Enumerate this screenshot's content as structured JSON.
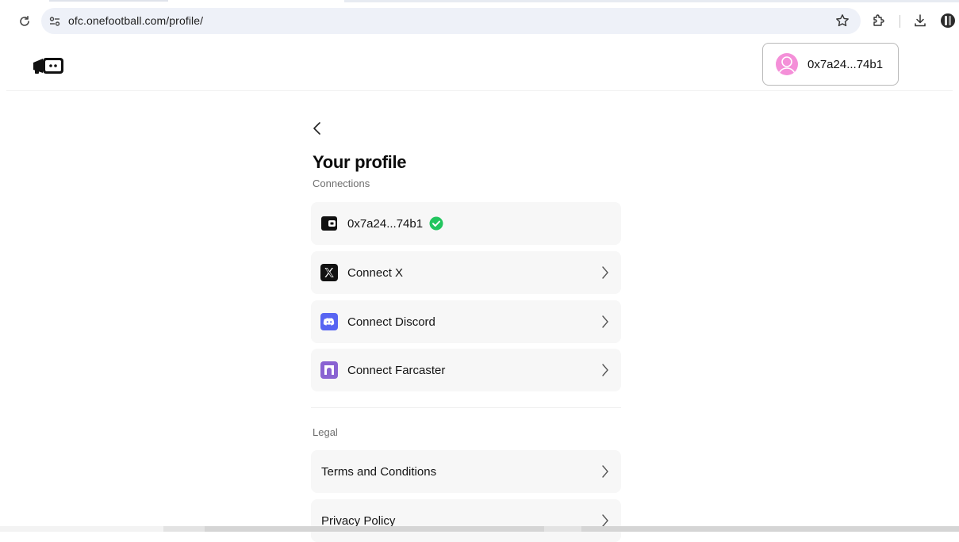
{
  "browser": {
    "url": "ofc.onefootball.com/profile/"
  },
  "header": {
    "wallet_address": "0x7a24...74b1"
  },
  "profile": {
    "title": "Your profile",
    "connections_label": "Connections",
    "wallet_row_address": "0x7a24...74b1",
    "connect_x_label": "Connect X",
    "connect_discord_label": "Connect Discord",
    "connect_farcaster_label": "Connect Farcaster",
    "legal_label": "Legal",
    "terms_label": "Terms and Conditions",
    "privacy_label": "Privacy Policy"
  },
  "colors": {
    "discord": "#5865F2",
    "farcaster": "#8A63D2",
    "verified": "#22c55e",
    "avatar": "#f48fd8"
  },
  "icons": [
    "reload-icon",
    "site-info-icon",
    "star-icon",
    "extensions-icon",
    "download-icon",
    "profile-icon",
    "wallet-icon",
    "x-logo-icon",
    "discord-icon",
    "farcaster-icon",
    "check-icon",
    "chevron-right-icon",
    "chevron-left-icon"
  ]
}
